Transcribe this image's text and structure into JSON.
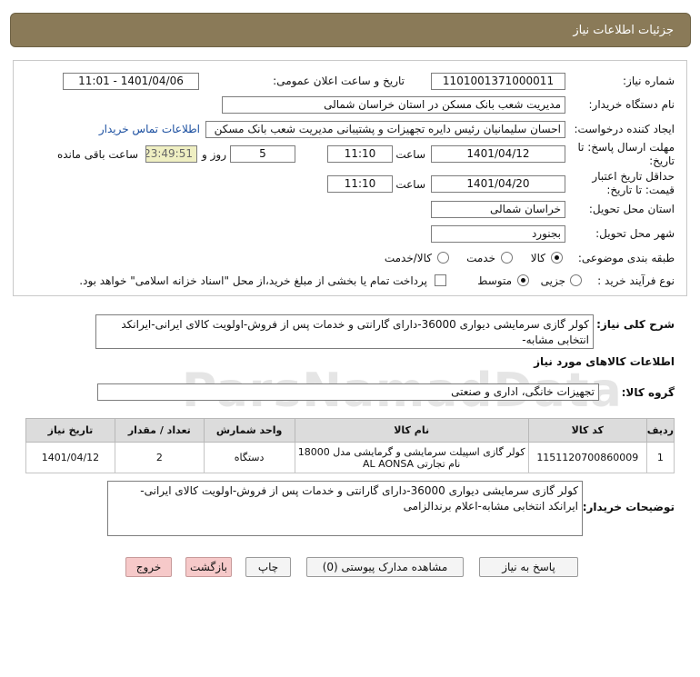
{
  "title": "جزئیات اطلاعات نیاز",
  "labels": {
    "need_number": "شماره نیاز:",
    "announce_datetime": "تاریخ و ساعت اعلان عمومی:",
    "buyer_name": "نام دستگاه خریدار:",
    "requester": "ایجاد کننده درخواست:",
    "reply_deadline": "مهلت ارسال پاسخ: تا تاریخ:",
    "hour": "ساعت",
    "day_and": "روز و",
    "remaining": "ساعت باقی مانده",
    "price_validity": "حداقل تاریخ اعتبار قیمت: تا تاریخ:",
    "delivery_province": "استان محل تحویل:",
    "delivery_city": "شهر محل تحویل:",
    "category": "طبقه بندی موضوعی:",
    "process_type": "نوع فرآیند خرید :",
    "need_summary": "شرح کلی نیاز:",
    "goods_info": "اطلاعات کالاهای مورد نیاز",
    "goods_group": "گروه کالا:",
    "buyer_notes": "توضیحات خریدار:"
  },
  "values": {
    "need_number": "1101001371000011",
    "announce_datetime": "1401/04/06 - 11:01",
    "buyer_name": "مدیریت شعب بانک مسکن در استان خراسان شمالی",
    "requester": "احسان  سلیمانیان رئیس دایره تجهیزات و پشتیبانی مدیریت شعب بانک مسکن",
    "contact_link": "اطلاعات تماس خریدار",
    "reply_date": "1401/04/12",
    "reply_time": "11:10",
    "days": "5",
    "timer": "23:49:51",
    "validity_date": "1401/04/20",
    "validity_time": "11:10",
    "province": "خراسان شمالی",
    "city": "بجنورد",
    "need_summary": "کولر گازی سرمایشی دیواری 36000-دارای گارانتی و خدمات پس از فروش-اولویت کالای ایرانی-ایرانکد انتخابی مشابه-",
    "goods_group": "تجهیزات خانگی، اداری و صنعتی",
    "buyer_notes": "کولر گازی سرمایشی دیواری 36000-دارای گارانتی و خدمات پس از فروش-اولویت کالای ایرانی-ایرانکد انتخابی مشابه-اعلام برندالزامی"
  },
  "category_options": [
    {
      "label": "کالا",
      "selected": true
    },
    {
      "label": "خدمت",
      "selected": false
    },
    {
      "label": "کالا/خدمت",
      "selected": false
    }
  ],
  "process_options": [
    {
      "label": "جزیی",
      "selected": false
    },
    {
      "label": "متوسط",
      "selected": true
    }
  ],
  "payment_note": "پرداخت تمام یا بخشی از مبلغ خرید،از محل \"اسناد خزانه اسلامی\" خواهد بود.",
  "table": {
    "headers": [
      "ردیف",
      "کد کالا",
      "نام کالا",
      "واحد شمارش",
      "تعداد / مقدار",
      "تاریخ نیاز"
    ],
    "rows": [
      [
        "1",
        "1151120700860009",
        "کولر گازی اسپیلت سرمایشی و گرمایشی مدل 18000 نام تجارتی AL AONSA",
        "دستگاه",
        "2",
        "1401/04/12"
      ]
    ]
  },
  "buttons": {
    "reply": "پاسخ به نیاز",
    "attachments": "مشاهده مدارک پیوستی (0)",
    "print": "چاپ",
    "back": "بازگشت",
    "exit": "خروج"
  },
  "watermark": "ParsNamadData"
}
